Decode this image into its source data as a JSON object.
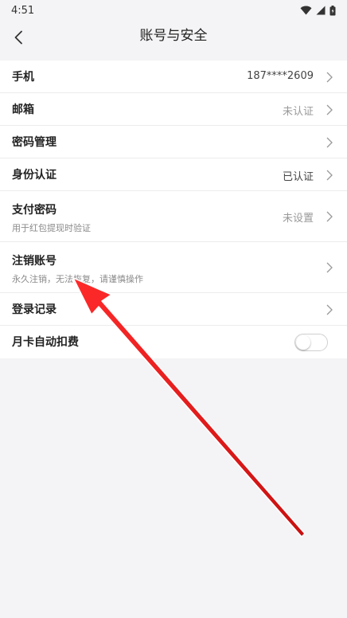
{
  "status_bar": {
    "time": "4:51",
    "icons": [
      "wifi-icon",
      "signal-icon",
      "battery-icon"
    ]
  },
  "header": {
    "title": "账号与安全",
    "back_icon": "chevron-left-icon"
  },
  "rows": [
    {
      "label": "手机",
      "value": "187****2609",
      "muted": false
    },
    {
      "label": "邮箱",
      "value": "未认证",
      "muted": true
    },
    {
      "label": "密码管理",
      "value": ""
    },
    {
      "label": "身份认证",
      "value": "已认证",
      "muted": false
    },
    {
      "label": "支付密码",
      "sub": "用于红包提现时验证",
      "value": "未设置",
      "muted": true
    },
    {
      "label": "注销账号",
      "sub": "永久注销，无法恢复，请谨慎操作",
      "value": ""
    },
    {
      "label": "登录记录",
      "value": ""
    },
    {
      "label": "月卡自动扣费",
      "toggle": false
    }
  ],
  "colors": {
    "background": "#f4f4f6",
    "card": "#ffffff",
    "annotation_arrow": "#e01e1e"
  }
}
